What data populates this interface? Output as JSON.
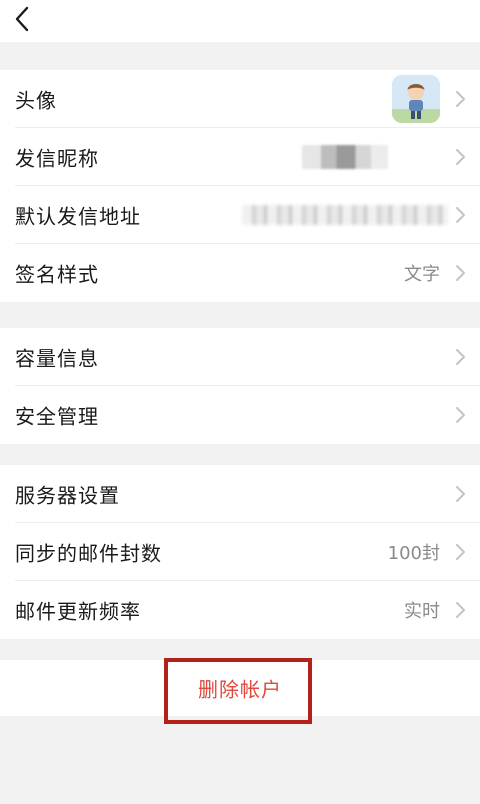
{
  "topbar": {
    "back_icon": "chevron-left-icon"
  },
  "groups": [
    {
      "rows": [
        {
          "label": "头像",
          "value_type": "avatar"
        },
        {
          "label": "发信昵称",
          "value_type": "blurred"
        },
        {
          "label": "默认发信地址",
          "value_type": "blurred"
        },
        {
          "label": "签名样式",
          "value": "文字"
        }
      ]
    },
    {
      "rows": [
        {
          "label": "容量信息"
        },
        {
          "label": "安全管理"
        }
      ]
    },
    {
      "rows": [
        {
          "label": "服务器设置"
        },
        {
          "label": "同步的邮件封数",
          "value": "100封"
        },
        {
          "label": "邮件更新频率",
          "value": "实时"
        }
      ]
    }
  ],
  "delete": {
    "label": "删除帐户"
  },
  "colors": {
    "accent": "#e0483c",
    "highlight": "#b3211b",
    "background": "#f2f2f2"
  }
}
